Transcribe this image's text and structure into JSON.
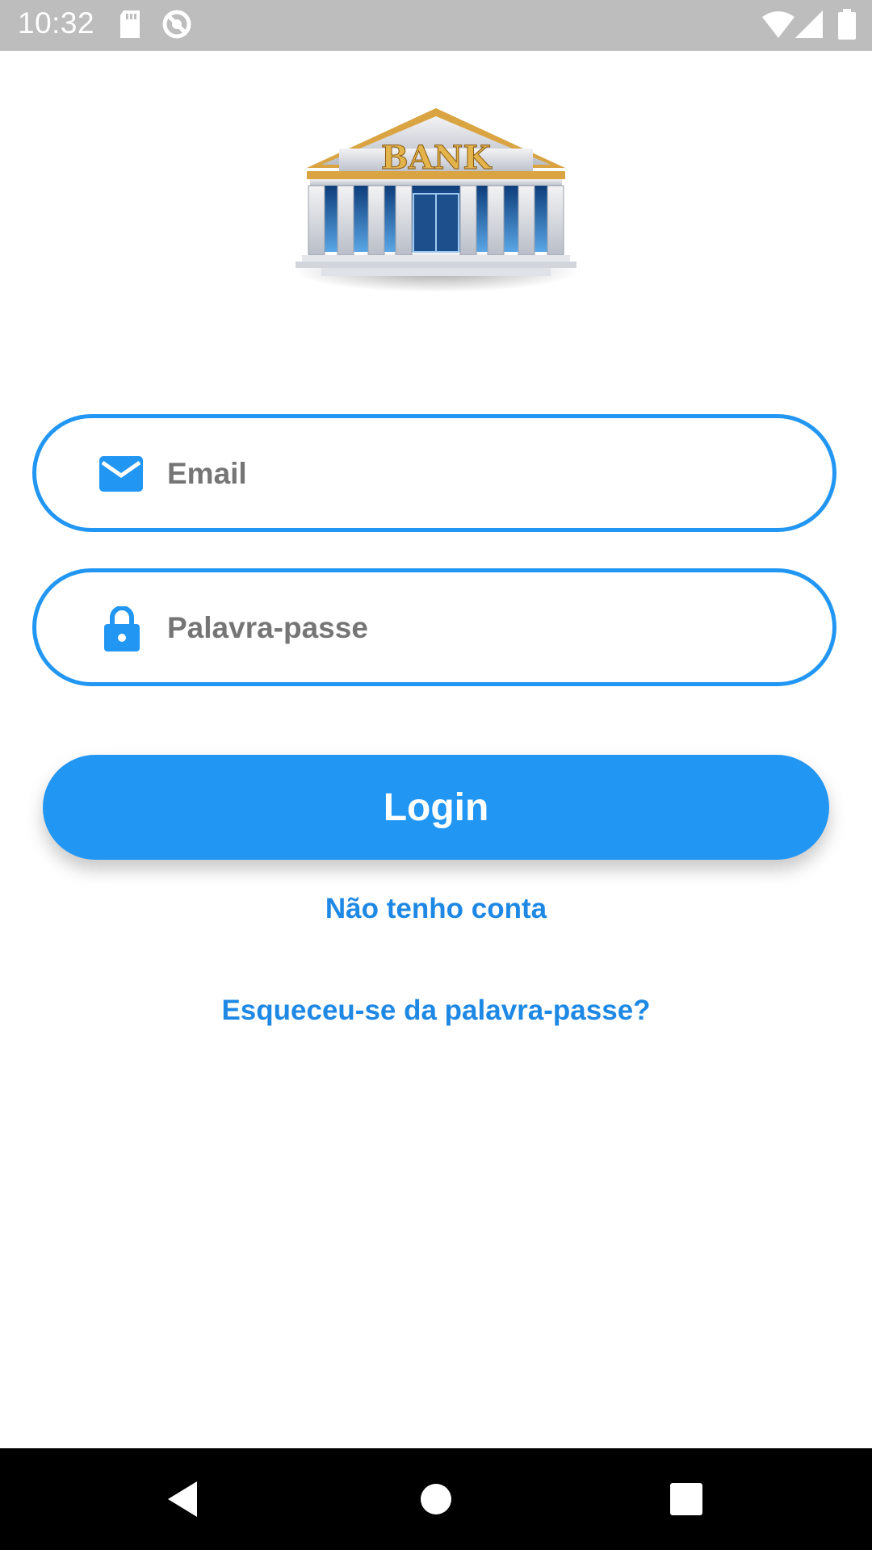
{
  "status_bar": {
    "time": "10:32",
    "icons": [
      "sd-card-icon",
      "sync-blocked-icon",
      "wifi-icon",
      "signal-icon",
      "battery-icon"
    ]
  },
  "logo": {
    "sign_text": "BANK",
    "icon": "bank-building-icon"
  },
  "form": {
    "email": {
      "placeholder": "Email",
      "value": "",
      "icon": "email-icon"
    },
    "password": {
      "placeholder": "Palavra-passe",
      "value": "",
      "icon": "lock-icon"
    },
    "login_label": "Login",
    "signup_link": "Não tenho conta",
    "forgot_link": "Esqueceu-se da palavra-passe?"
  },
  "nav_bar": {
    "icons": [
      "back-icon",
      "home-icon",
      "recents-icon"
    ]
  },
  "colors": {
    "accent": "#2196f3",
    "link": "#1e88e5",
    "placeholder": "#757575",
    "status_bar": "#bdbdbd",
    "nav_bar": "#000000"
  }
}
